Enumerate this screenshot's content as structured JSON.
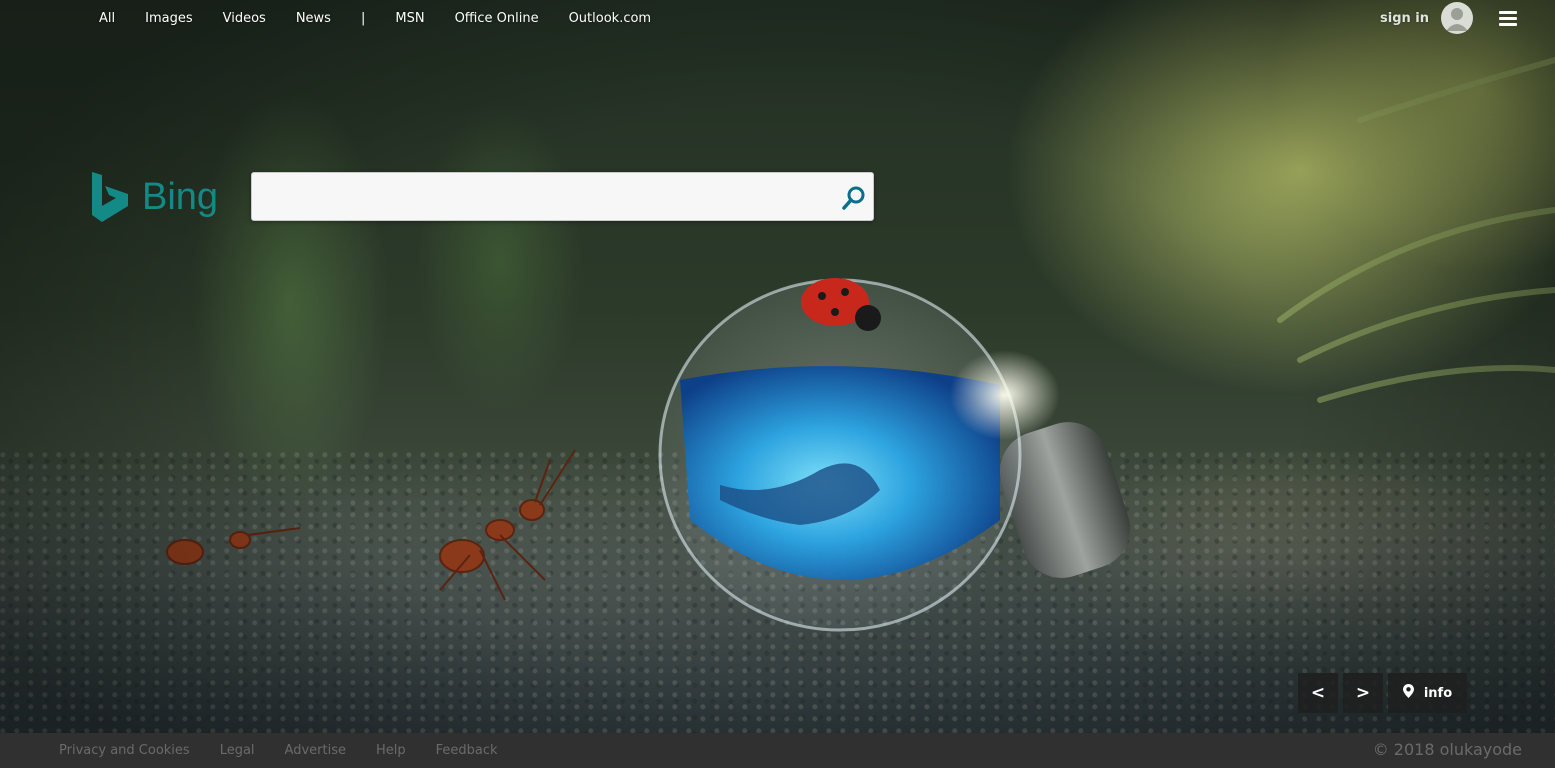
{
  "topnav": {
    "links": [
      "All",
      "Images",
      "Videos",
      "News"
    ],
    "separator": "|",
    "external_links": [
      "MSN",
      "Office Online",
      "Outlook.com"
    ]
  },
  "account": {
    "signin_label": "sign in"
  },
  "logo": {
    "text": "Bing",
    "color": "#138a86"
  },
  "search": {
    "value": "",
    "placeholder": "",
    "icon": "search-icon",
    "accent_color": "#0a6f8a"
  },
  "image_nav": {
    "prev_label": "<",
    "next_label": ">",
    "info_label": "info",
    "info_icon": "map-pin-icon"
  },
  "footer": {
    "links": [
      "Privacy and Cookies",
      "Legal",
      "Advertise",
      "Help",
      "Feedback"
    ],
    "copyright": "© 2018 olukayode"
  }
}
